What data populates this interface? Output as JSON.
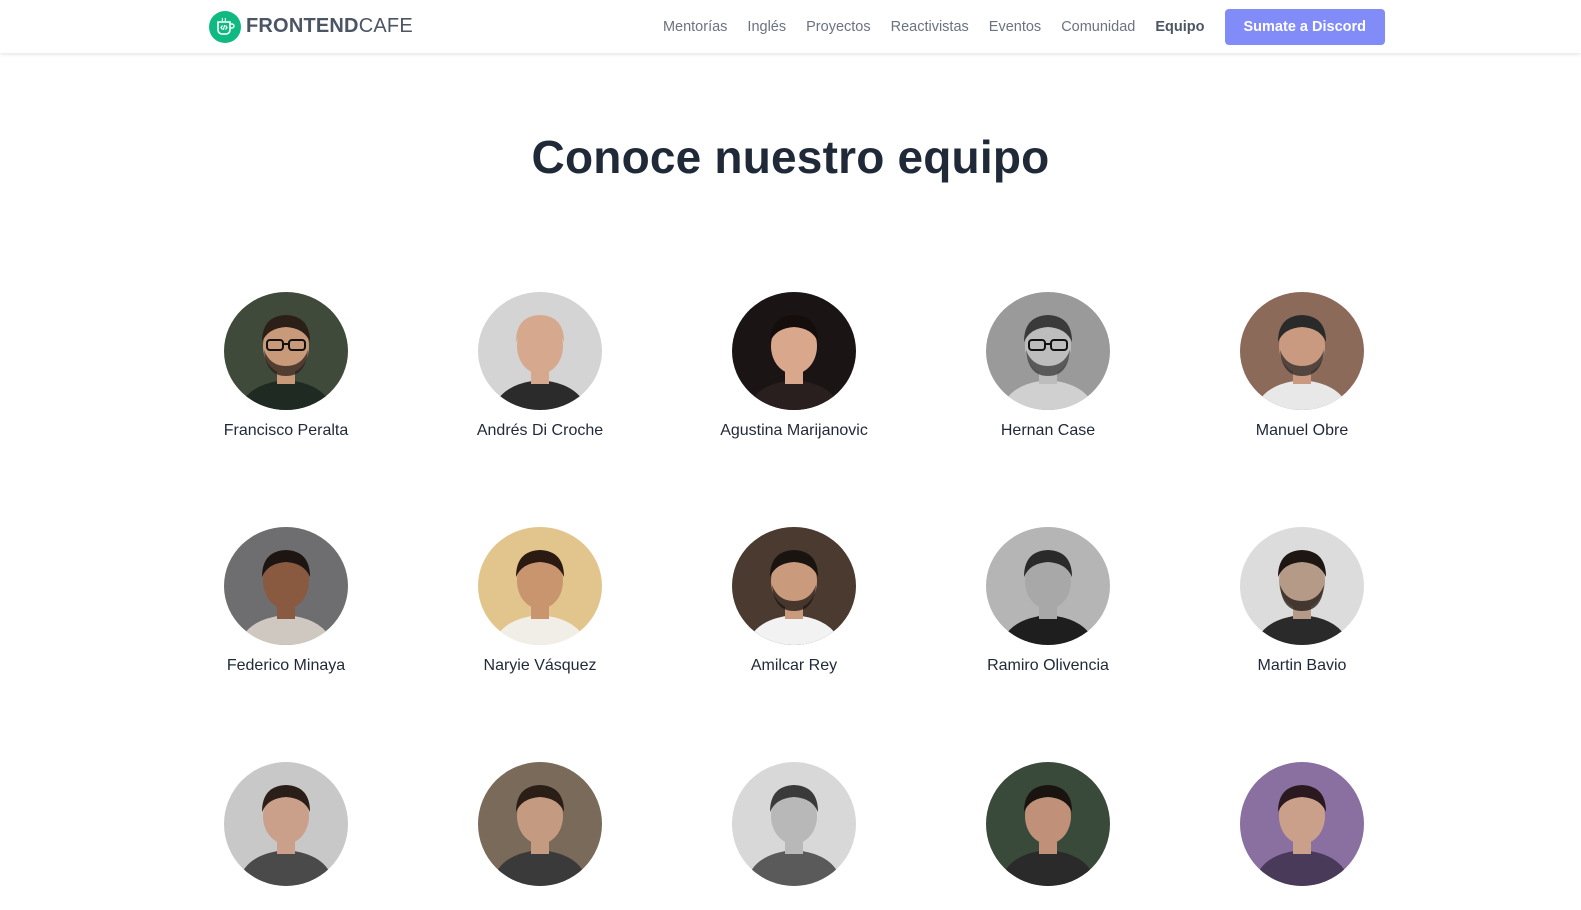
{
  "brand": {
    "name_bold": "FRONTEND",
    "name_light": "CAFE",
    "logo_icon": "code-cup-icon",
    "color": "#10b981"
  },
  "nav": {
    "links": [
      "Mentorías",
      "Inglés",
      "Proyectos",
      "Reactivistas",
      "Eventos",
      "Comunidad",
      "Equipo"
    ],
    "active": "Equipo",
    "cta_label": "Sumate a Discord",
    "cta_color": "#818cf8"
  },
  "page": {
    "title": "Conoce nuestro equipo"
  },
  "team": [
    {
      "name": "Francisco Peralta",
      "bg": "#3f4a3a",
      "skin": "#c89a7a",
      "hair": "#2b1f18",
      "shirt": "#1f2a22",
      "glasses": true,
      "beard": true
    },
    {
      "name": "Andrés Di Croche",
      "bg": "#d4d4d4",
      "skin": "#d6a98e",
      "hair": "#d6a98e",
      "shirt": "#2b2b2b",
      "glasses": false,
      "beard": false
    },
    {
      "name": "Agustina Marijanovic",
      "bg": "#1a1414",
      "skin": "#d9a78c",
      "hair": "#140d0c",
      "shirt": "#2a1f1f",
      "glasses": false,
      "beard": false
    },
    {
      "name": "Hernan Case",
      "bg": "#9a9a9a",
      "skin": "#bdbdbd",
      "hair": "#3a3a3a",
      "shirt": "#d0d0d0",
      "glasses": true,
      "beard": true
    },
    {
      "name": "Manuel Obre",
      "bg": "#8c6a5a",
      "skin": "#c99a80",
      "hair": "#2a2a2a",
      "shirt": "#e8e8e8",
      "glasses": false,
      "beard": true
    },
    {
      "name": "Federico Minaya",
      "bg": "#6e6e70",
      "skin": "#8a5a40",
      "hair": "#1c1512",
      "shirt": "#cfc8c0",
      "glasses": false,
      "beard": false
    },
    {
      "name": "Naryie Vásquez",
      "bg": "#e2c58c",
      "skin": "#c9956f",
      "hair": "#2a1a12",
      "shirt": "#f1eee8",
      "glasses": false,
      "beard": false
    },
    {
      "name": "Amilcar Rey",
      "bg": "#4a3a30",
      "skin": "#c99a7c",
      "hair": "#1a1411",
      "shirt": "#f2f2f2",
      "glasses": false,
      "beard": true
    },
    {
      "name": "Ramiro Olivencia",
      "bg": "#b5b5b5",
      "skin": "#a8a8a8",
      "hair": "#2a2a2a",
      "shirt": "#1e1e1e",
      "glasses": false,
      "beard": false
    },
    {
      "name": "Martin Bavio",
      "bg": "#dcdcdc",
      "skin": "#b59a88",
      "hair": "#1e1612",
      "shirt": "#2a2a2a",
      "glasses": false,
      "beard": true
    },
    {
      "name": "",
      "bg": "#c8c8c8",
      "skin": "#caa08a",
      "hair": "#2a1f18",
      "shirt": "#4a4a4a",
      "glasses": false,
      "beard": false
    },
    {
      "name": "",
      "bg": "#7a6a5a",
      "skin": "#c49a80",
      "hair": "#2a1e16",
      "shirt": "#3a3a3a",
      "glasses": false,
      "beard": false
    },
    {
      "name": "",
      "bg": "#d8d8d8",
      "skin": "#b8b8b8",
      "hair": "#3a3a3a",
      "shirt": "#5a5a5a",
      "glasses": false,
      "beard": false
    },
    {
      "name": "",
      "bg": "#3a4a3a",
      "skin": "#c09078",
      "hair": "#1a1410",
      "shirt": "#2a2a2a",
      "glasses": false,
      "beard": false
    },
    {
      "name": "",
      "bg": "#8a70a0",
      "skin": "#caa08a",
      "hair": "#2a1a20",
      "shirt": "#4a3a5a",
      "glasses": false,
      "beard": false
    }
  ]
}
